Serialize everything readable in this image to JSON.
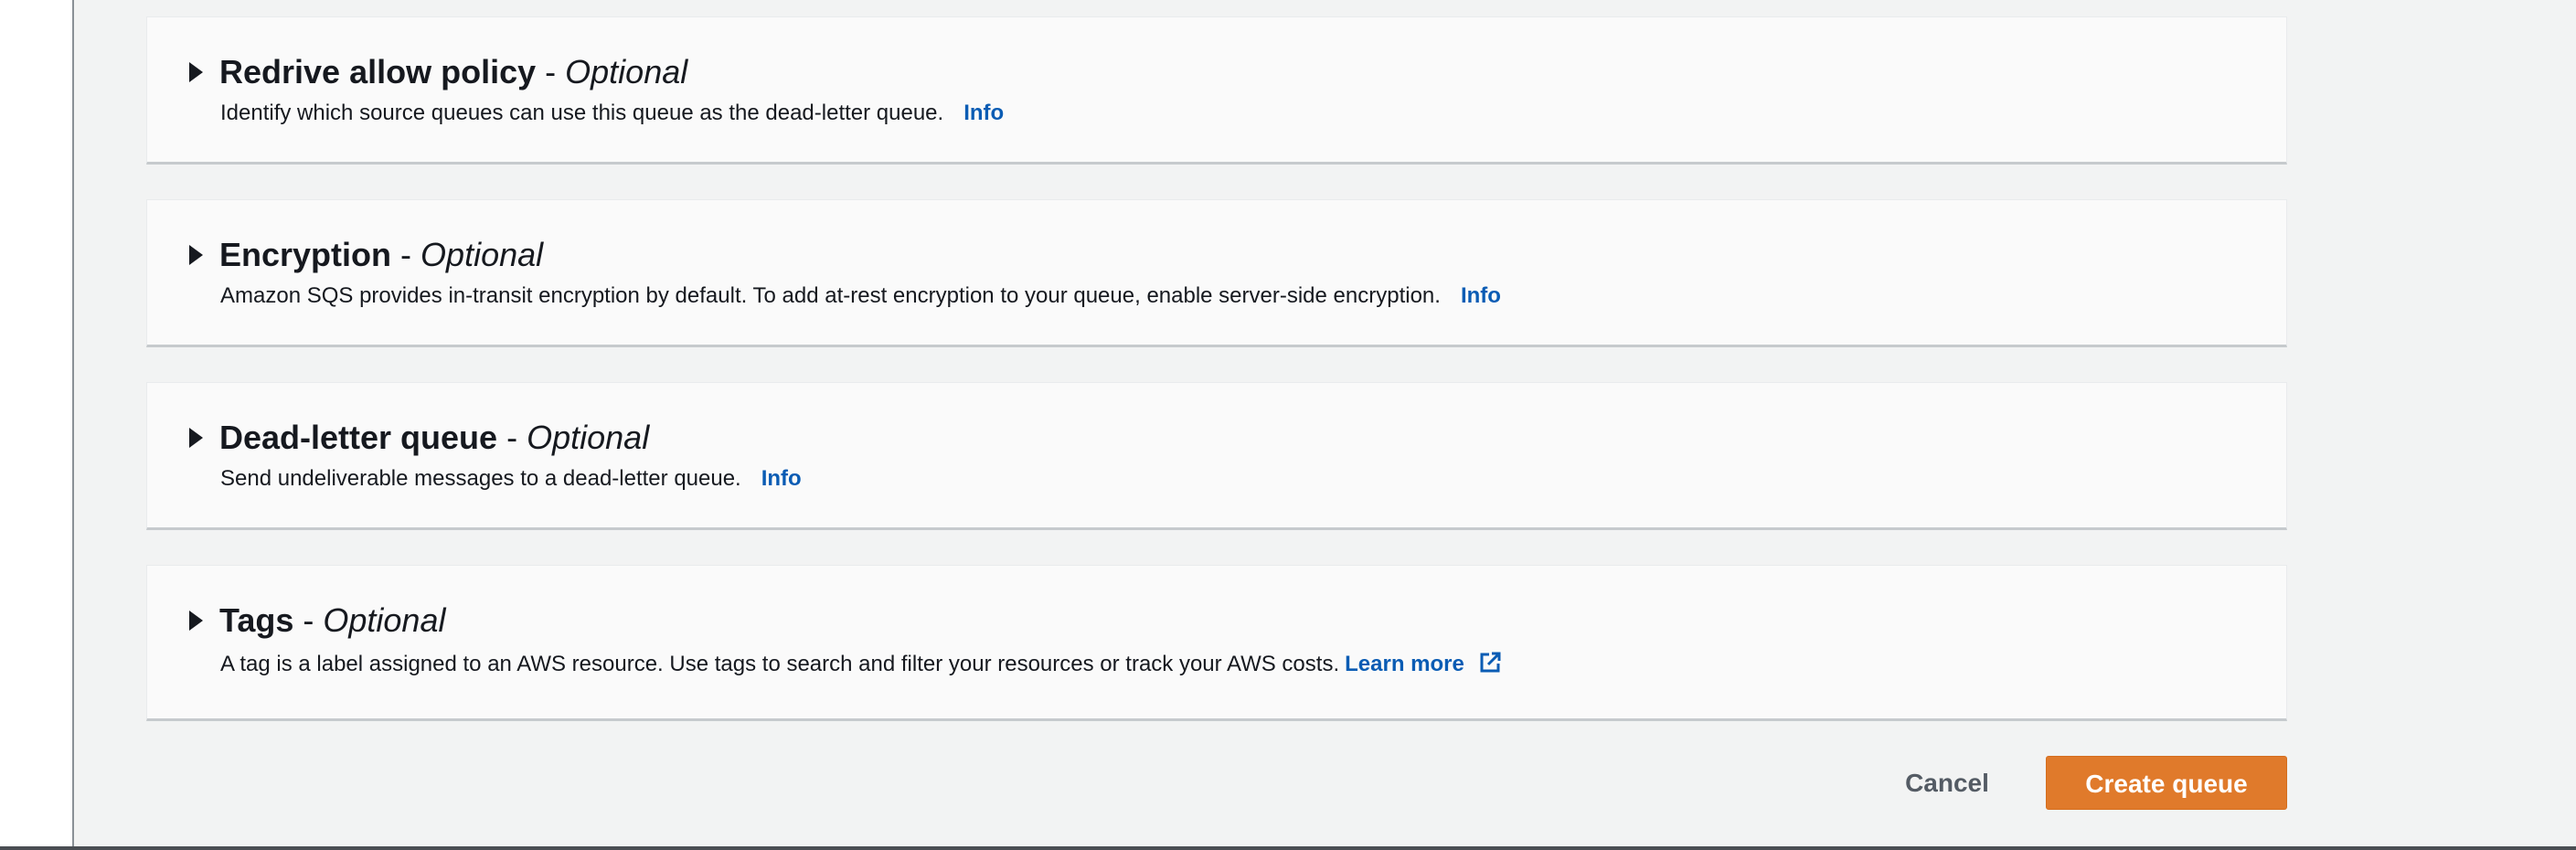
{
  "sections": [
    {
      "title": "Redrive allow policy",
      "separator": "-",
      "optional": "Optional",
      "description": "Identify which source queues can use this queue as the dead-letter queue.",
      "info": "Info"
    },
    {
      "title": "Encryption",
      "separator": "-",
      "optional": "Optional",
      "description": "Amazon SQS provides in-transit encryption by default. To add at-rest encryption to your queue, enable server-side encryption.",
      "info": "Info"
    },
    {
      "title": "Dead-letter queue",
      "separator": "-",
      "optional": "Optional",
      "description": "Send undeliverable messages to a dead-letter queue.",
      "info": "Info"
    },
    {
      "title": "Tags",
      "separator": "-",
      "optional": "Optional",
      "description": "A tag is a label assigned to an AWS resource. Use tags to search and filter your resources or track your AWS costs.",
      "learn_more": "Learn more",
      "link_icon": "external-link-icon"
    }
  ],
  "actions": {
    "cancel": "Cancel",
    "create": "Create queue"
  },
  "colors": {
    "link": "#0a5cb4",
    "primary_button": "#e07a2b"
  }
}
